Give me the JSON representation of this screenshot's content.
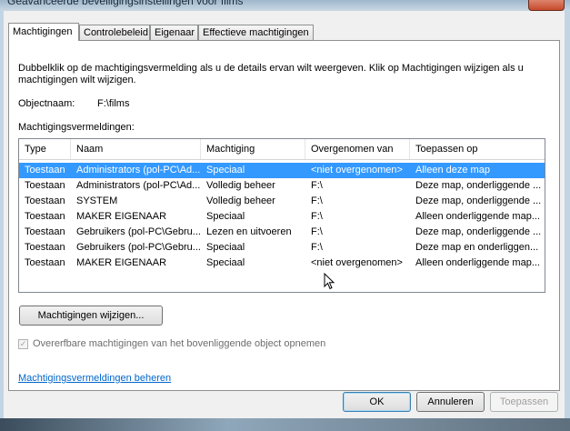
{
  "window": {
    "title": "Geavanceerde beveiligingsinstellingen voor films"
  },
  "tabs": [
    {
      "label": "Machtigingen",
      "active": true
    },
    {
      "label": "Controlebeleid",
      "active": false
    },
    {
      "label": "Eigenaar",
      "active": false
    },
    {
      "label": "Effectieve machtigingen",
      "active": false
    }
  ],
  "permissions_tab": {
    "description": "Dubbelklik op de machtigingsvermelding als u de details ervan wilt weergeven. Klik op Machtigingen wijzigen als u machtigingen wilt wijzigen.",
    "object_name_label": "Objectnaam:",
    "object_name_value": "F:\\films",
    "entries_label": "Machtigingsvermeldingen:",
    "columns": [
      "Type",
      "Naam",
      "Machtiging",
      "Overgenomen van",
      "Toepassen op"
    ],
    "rows": [
      {
        "type": "Toestaan",
        "name": "Administrators (pol-PC\\Ad...",
        "permission": "Speciaal",
        "inherited_from": "<niet overgenomen>",
        "apply_to": "Alleen deze map",
        "selected": true
      },
      {
        "type": "Toestaan",
        "name": "Administrators (pol-PC\\Ad...",
        "permission": "Volledig beheer",
        "inherited_from": "F:\\",
        "apply_to": "Deze map, onderliggende ...",
        "selected": false
      },
      {
        "type": "Toestaan",
        "name": "SYSTEM",
        "permission": "Volledig beheer",
        "inherited_from": "F:\\",
        "apply_to": "Deze map, onderliggende ...",
        "selected": false
      },
      {
        "type": "Toestaan",
        "name": "MAKER EIGENAAR",
        "permission": "Speciaal",
        "inherited_from": "F:\\",
        "apply_to": "Alleen onderliggende map...",
        "selected": false
      },
      {
        "type": "Toestaan",
        "name": "Gebruikers (pol-PC\\Gebru...",
        "permission": "Lezen en uitvoeren",
        "inherited_from": "F:\\",
        "apply_to": "Deze map, onderliggende ...",
        "selected": false
      },
      {
        "type": "Toestaan",
        "name": "Gebruikers (pol-PC\\Gebru...",
        "permission": "Speciaal",
        "inherited_from": "F:\\",
        "apply_to": "Deze map en onderliggen...",
        "selected": false
      },
      {
        "type": "Toestaan",
        "name": "MAKER EIGENAAR",
        "permission": "Speciaal",
        "inherited_from": "<niet overgenomen>",
        "apply_to": "Alleen onderliggende map...",
        "selected": false
      }
    ],
    "change_button": "Machtigingen wijzigen...",
    "inherit_checkbox_label": "Overerfbare machtigingen van het bovenliggende object opnemen",
    "inherit_checked": true,
    "manage_link": "Machtigingsvermeldingen beheren"
  },
  "buttons": {
    "ok": "OK",
    "cancel": "Annuleren",
    "apply": "Toepassen"
  },
  "colors": {
    "selection": "#3399ff",
    "link": "#0066cc"
  }
}
